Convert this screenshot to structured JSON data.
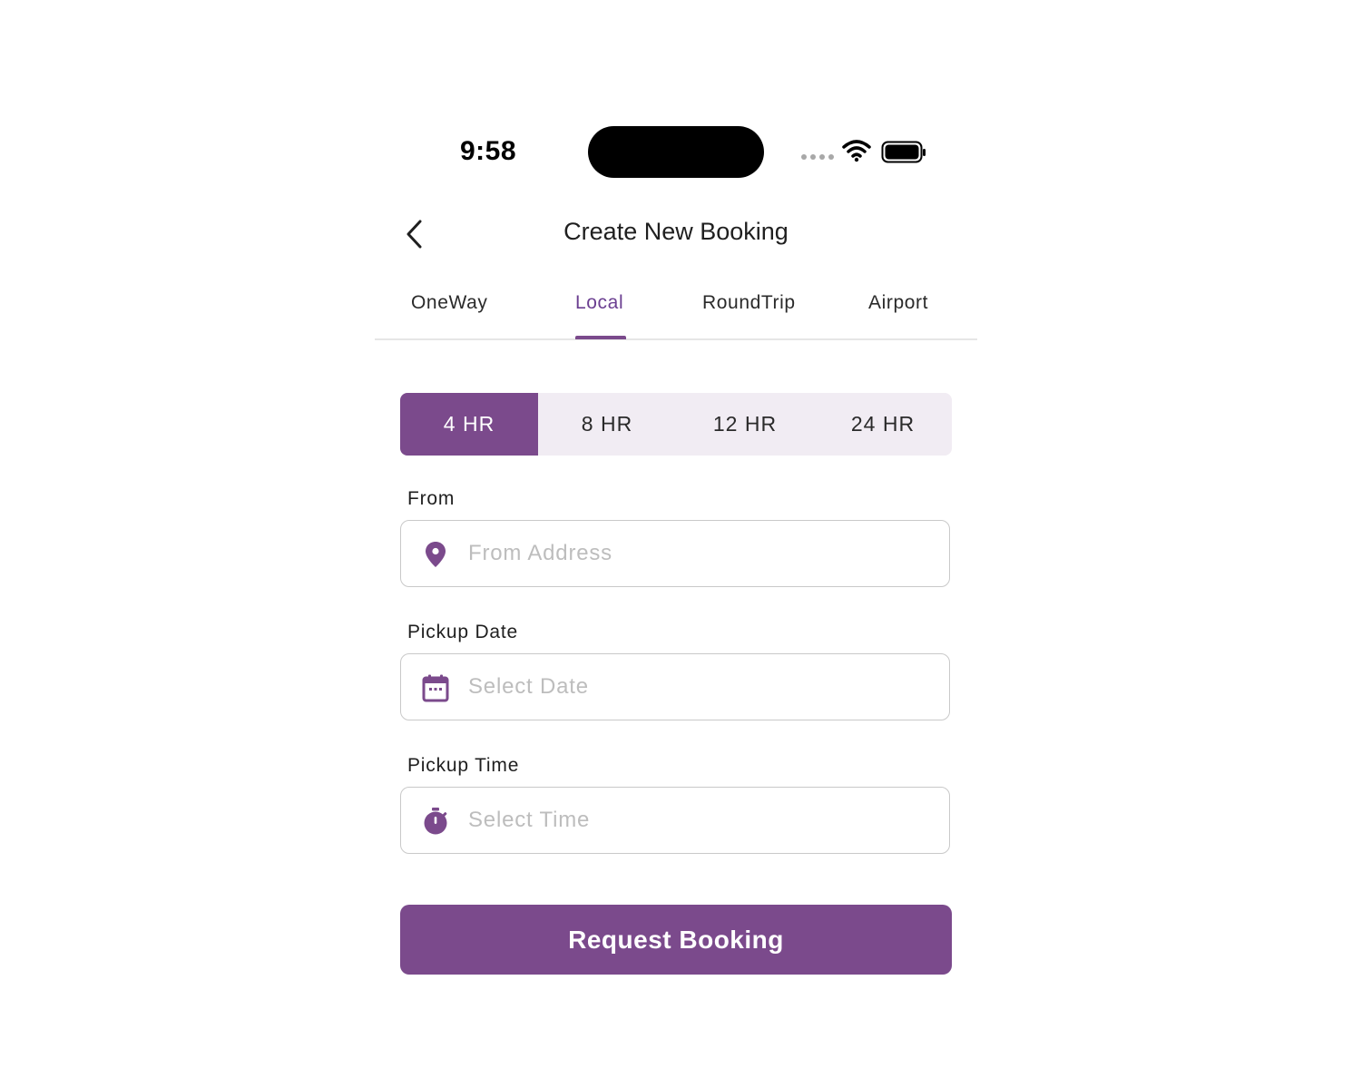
{
  "status_bar": {
    "time": "9:58"
  },
  "header": {
    "title": "Create New Booking",
    "back_icon": "chevron-left-icon"
  },
  "tabs": [
    {
      "label": "OneWay",
      "active": false
    },
    {
      "label": "Local",
      "active": true
    },
    {
      "label": "RoundTrip",
      "active": false
    },
    {
      "label": "Airport",
      "active": false
    }
  ],
  "durations": [
    {
      "label": "4 HR",
      "selected": true
    },
    {
      "label": "8 HR",
      "selected": false
    },
    {
      "label": "12 HR",
      "selected": false
    },
    {
      "label": "24 HR",
      "selected": false
    }
  ],
  "form": {
    "from": {
      "label": "From",
      "placeholder": "From Address",
      "value": "",
      "icon": "location-pin-icon"
    },
    "pickup_date": {
      "label": "Pickup Date",
      "placeholder": "Select Date",
      "value": "",
      "icon": "calendar-icon"
    },
    "pickup_time": {
      "label": "Pickup Time",
      "placeholder": "Select Time",
      "value": "",
      "icon": "stopwatch-icon"
    }
  },
  "submit_label": "Request Booking",
  "colors": {
    "accent": "#7b4a8c",
    "accent_text": "#6b3f91",
    "segment_bg": "#f1ecf3",
    "placeholder": "#bdbdbd"
  }
}
